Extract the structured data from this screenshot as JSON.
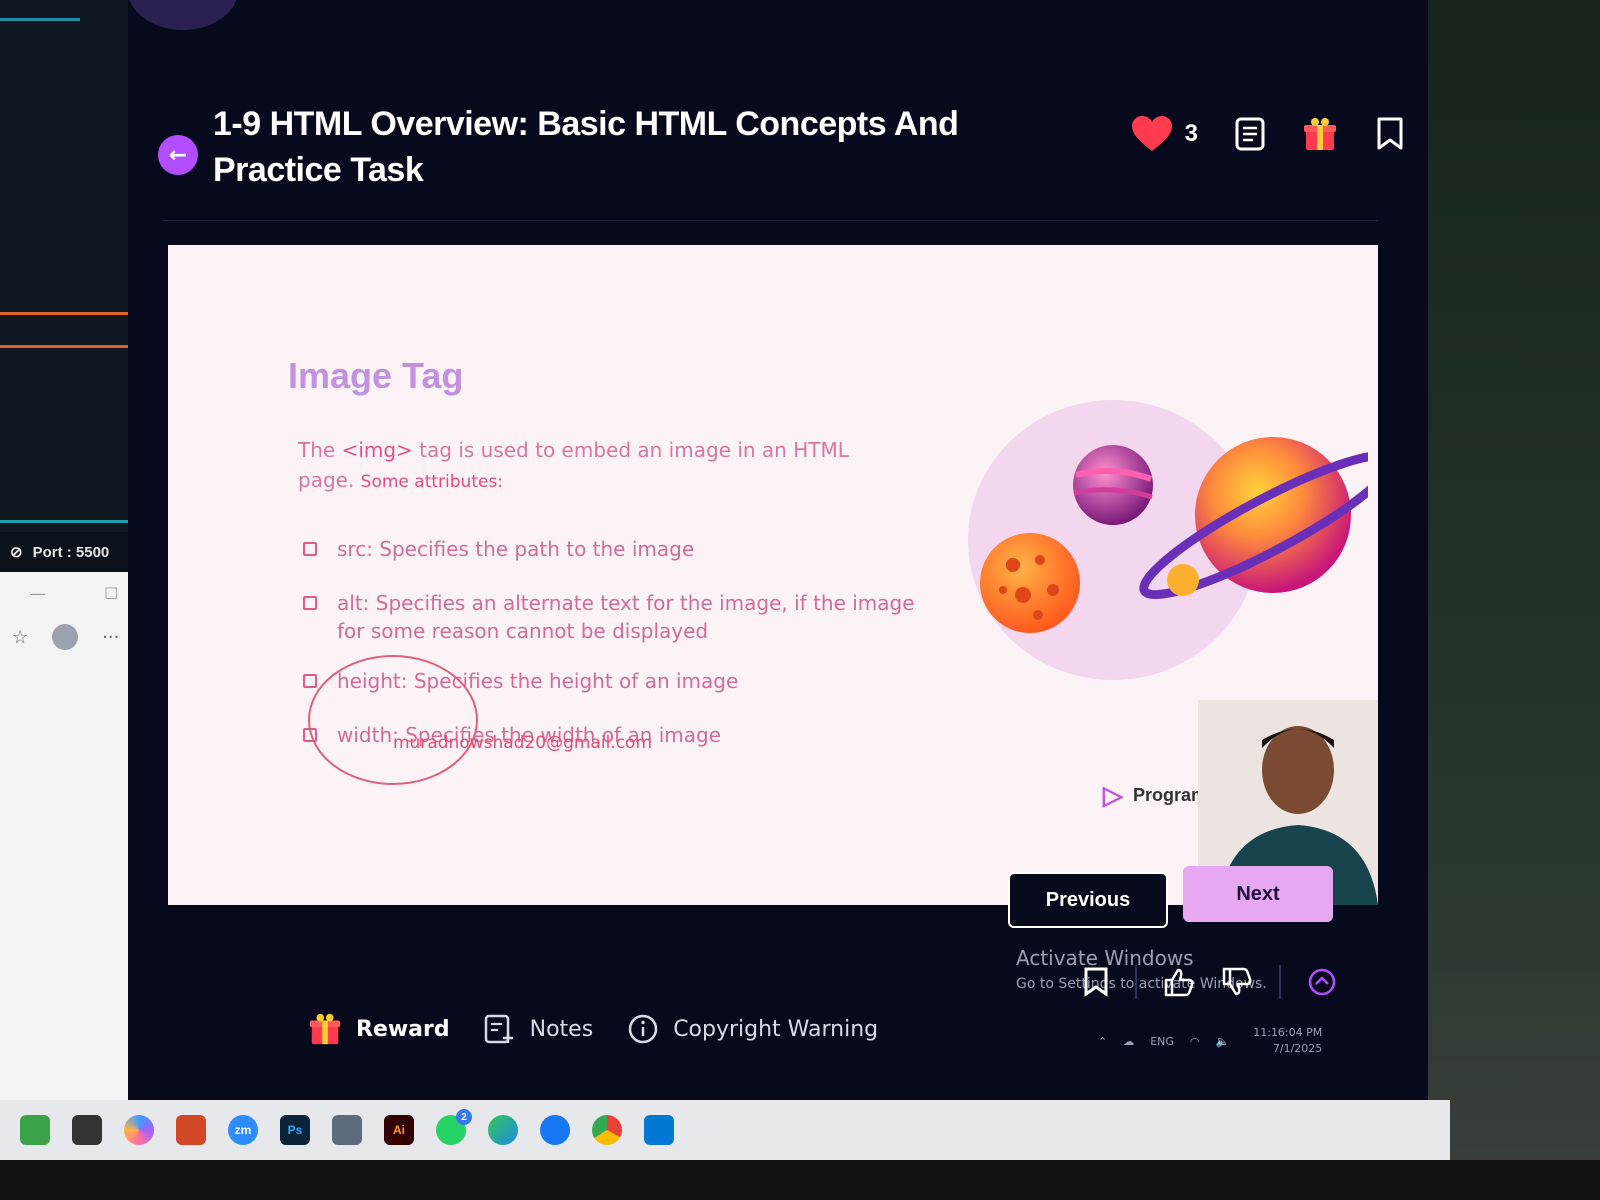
{
  "status_bar": {
    "port": "Port : 5500"
  },
  "lesson": {
    "title": "1-9 HTML Overview: Basic HTML Concepts And Practice Task",
    "like_count": "3"
  },
  "slide": {
    "heading": "Image Tag",
    "intro_prefix": "The ",
    "intro_tag": "<img>",
    "intro_rest": " tag is used to embed an image in an HTML page. ",
    "intro_sub": "Some attributes:",
    "attributes": [
      "src: Specifies the path to the image",
      "alt: Specifies an alternate text for the image, if the image for some reason cannot be displayed",
      "height: Specifies the height of an image",
      "width: Specifies the width of an image"
    ],
    "watermark": "muradnowshad20@gmail.com",
    "brand": "Programmi"
  },
  "nav": {
    "previous": "Previous",
    "next": "Next"
  },
  "activate_windows": {
    "line1": "Activate Windows",
    "line2": "Go to Settings to activate Windows."
  },
  "bottom_bar": {
    "reward": "Reward",
    "notes": "Notes",
    "copyright": "Copyright Warning"
  },
  "tray": {
    "lang": "ENG",
    "time": "11:16:04 PM",
    "date": "7/1/2025"
  },
  "taskbar": {
    "apps": [
      "minecraft",
      "qr",
      "copilot",
      "powerpoint",
      "zoom",
      "photoshop",
      "calculator",
      "illustrator",
      "whatsapp",
      "edge",
      "facebook",
      "chrome",
      "vscode"
    ],
    "zoom_label": "zm",
    "ps_label": "Ps",
    "ai_label": "Ai",
    "whatsapp_badge": "2"
  },
  "colors": {
    "app_bg": "#070a1c",
    "accent_purple": "#b44dff",
    "next_button": "#e7a8f2",
    "slide_heading": "#c291e0",
    "slide_text": "#d56a96",
    "heart": "#ff3b4d"
  }
}
